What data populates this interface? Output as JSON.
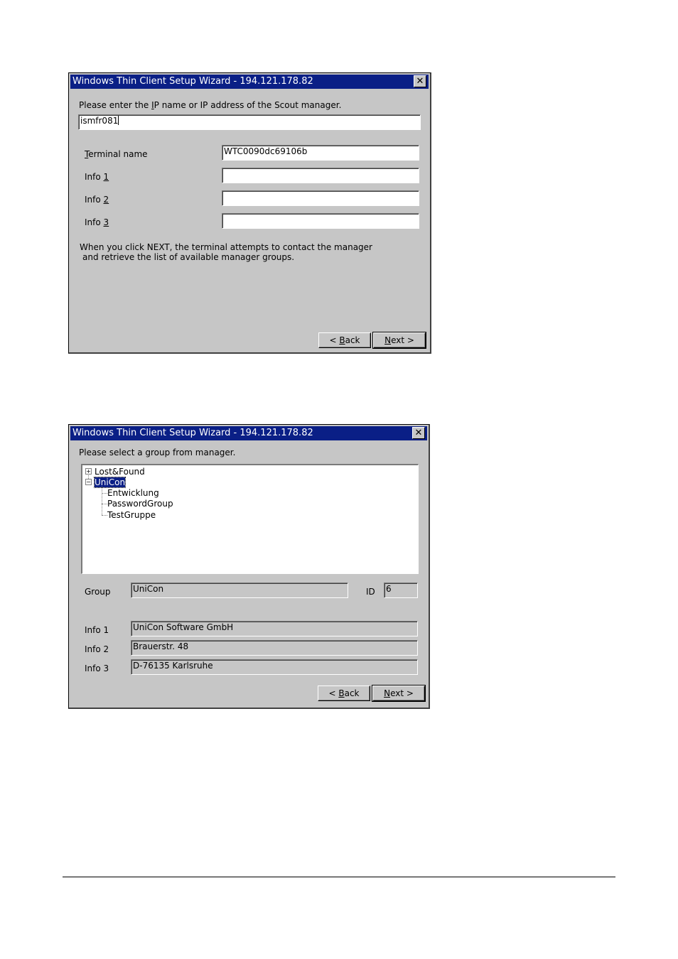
{
  "dialog1": {
    "title": "Windows Thin Client Setup Wizard - 194.121.178.82",
    "close_glyph": "✕",
    "prompt_pre": "Please enter the ",
    "prompt_u": "I",
    "prompt_post": "P name or IP address of the Scout manager.",
    "manager_value": "ismfr081",
    "terminal_label_u": "T",
    "terminal_label_rest": "erminal name",
    "terminal_value": "WTC0090dc69106b",
    "info1_label": "Info ",
    "info1_key": "1",
    "info1_value": "",
    "info2_label": "Info ",
    "info2_key": "2",
    "info2_value": "",
    "info3_label": "Info ",
    "info3_key": "3",
    "info3_value": "",
    "note_line1": "When you click NEXT, the terminal attempts to contact the manager",
    "note_line2": "and retrieve the list of available manager groups.",
    "back_pre": "< ",
    "back_u": "B",
    "back_rest": "ack",
    "next_u": "N",
    "next_rest": "ext >"
  },
  "dialog2": {
    "title": "Windows Thin Client Setup Wizard - 194.121.178.82",
    "close_glyph": "✕",
    "prompt": "Please select a group from manager.",
    "tree": {
      "root1": "Lost&Found",
      "root2": "UniCon",
      "child1": "Entwicklung",
      "child2": "PasswordGroup",
      "child3": "TestGruppe",
      "plus": "+",
      "minus": "−"
    },
    "group_label": "Group",
    "group_value": "UniCon",
    "id_label": "ID",
    "id_value": "6",
    "info1_label": "Info 1",
    "info1_value": "UniCon Software GmbH",
    "info2_label": "Info 2",
    "info2_value": "Brauerstr. 48",
    "info3_label": "Info 3",
    "info3_value": "D-76135 Karlsruhe",
    "back_pre": "< ",
    "back_u": "B",
    "back_rest": "ack",
    "next_u": "N",
    "next_rest": "ext >"
  }
}
